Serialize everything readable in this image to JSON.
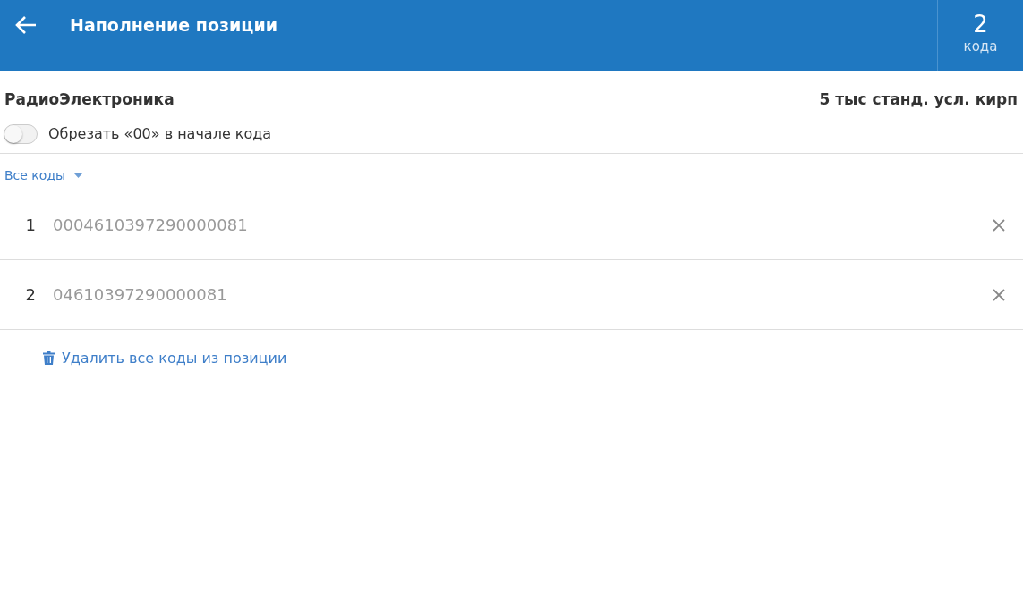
{
  "header": {
    "title": "Наполнение позиции",
    "count": "2",
    "count_label": "кода"
  },
  "position": {
    "name": "РадиоЭлектроника",
    "quantity": "5 тыс станд. усл. кирп"
  },
  "trim_toggle": {
    "label": "Обрезать «00» в начале кода",
    "on": false
  },
  "filter": {
    "label": "Все коды"
  },
  "codes": [
    {
      "number": "1",
      "code": "0004610397290000081"
    },
    {
      "number": "2",
      "code": "04610397290000081"
    }
  ],
  "delete_all": {
    "label": "Удалить все коды из позиции"
  }
}
